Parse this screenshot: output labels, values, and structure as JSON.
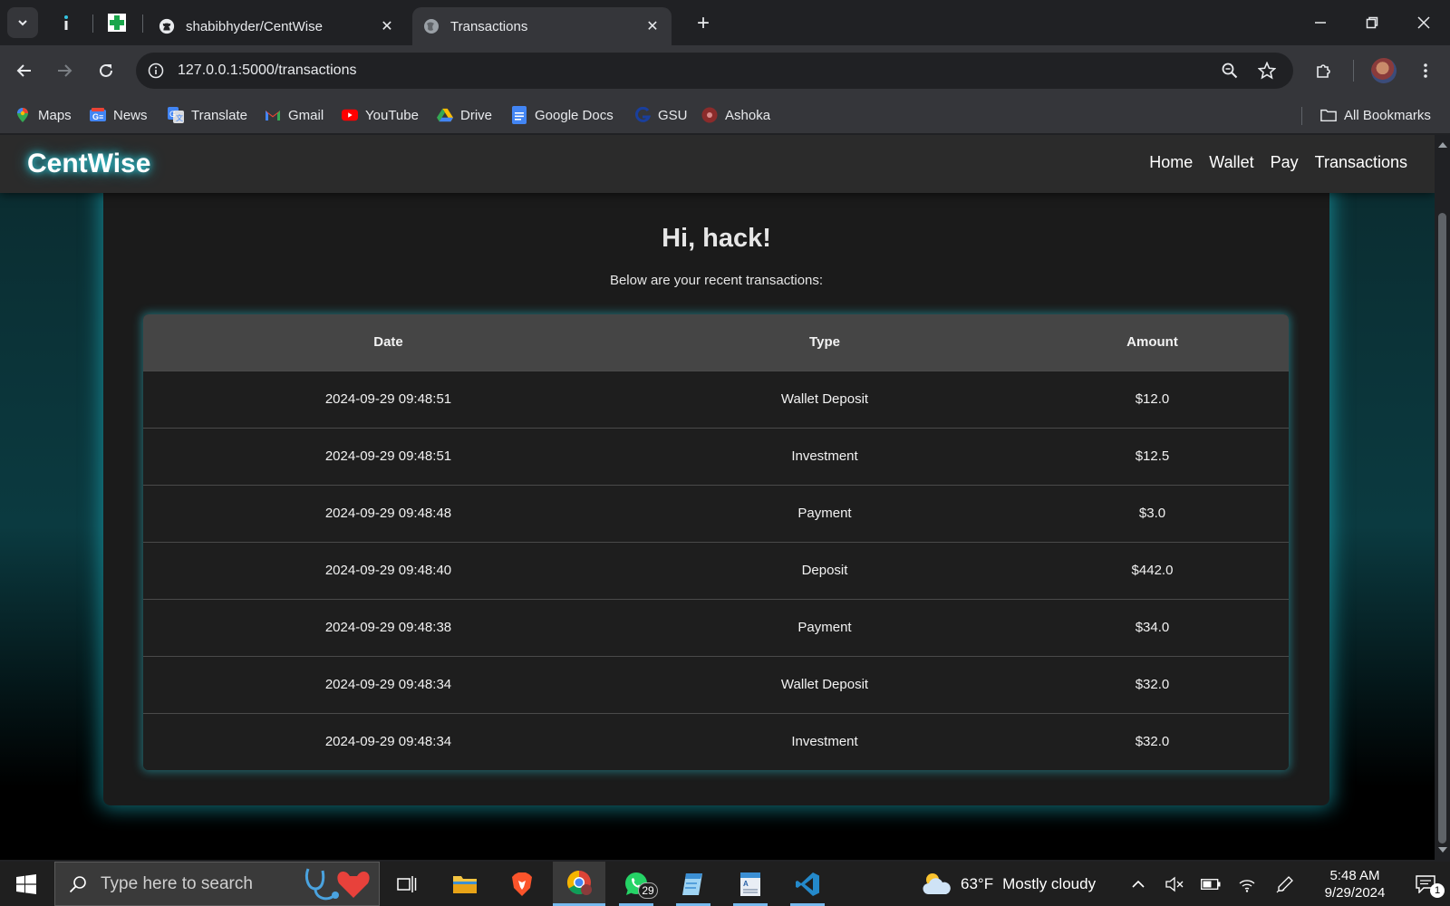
{
  "browser": {
    "tabs": [
      {
        "title": "shabibhyder/CentWise",
        "active": false
      },
      {
        "title": "Transactions",
        "active": true
      }
    ],
    "url": "127.0.0.1:5000/transactions",
    "bookmarks": [
      "Maps",
      "News",
      "Translate",
      "Gmail",
      "YouTube",
      "Drive",
      "Google Docs",
      "GSU",
      "Ashoka"
    ],
    "all_bookmarks": "All Bookmarks"
  },
  "app": {
    "brand": "CentWise",
    "nav": [
      "Home",
      "Wallet",
      "Pay",
      "Transactions"
    ],
    "greeting": "Hi, hack!",
    "subtitle": "Below are your recent transactions:",
    "table": {
      "headers": [
        "Date",
        "Type",
        "Amount"
      ],
      "rows": [
        [
          "2024-09-29 09:48:51",
          "Wallet Deposit",
          "$12.0"
        ],
        [
          "2024-09-29 09:48:51",
          "Investment",
          "$12.5"
        ],
        [
          "2024-09-29 09:48:48",
          "Payment",
          "$3.0"
        ],
        [
          "2024-09-29 09:48:40",
          "Deposit",
          "$442.0"
        ],
        [
          "2024-09-29 09:48:38",
          "Payment",
          "$34.0"
        ],
        [
          "2024-09-29 09:48:34",
          "Wallet Deposit",
          "$32.0"
        ],
        [
          "2024-09-29 09:48:34",
          "Investment",
          "$32.0"
        ]
      ]
    },
    "colors": {
      "accent_glow": "#32d7e6",
      "card_bg": "#1b1b1b",
      "header_bg": "#454545"
    }
  },
  "taskbar": {
    "search_placeholder": "Type here to search",
    "whatsapp_badge": "29",
    "weather": {
      "temp": "63°F",
      "condition": "Mostly cloudy"
    },
    "time": "5:48 AM",
    "date": "9/29/2024",
    "notifications": "1"
  }
}
